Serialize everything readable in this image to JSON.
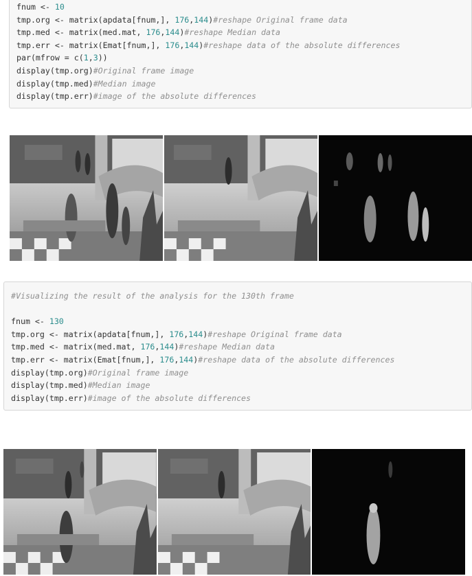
{
  "block1": {
    "l1": {
      "a": "fnum <- ",
      "n": "10"
    },
    "l2": {
      "a": "tmp.org <- matrix(apdata[fnum,], ",
      "n1": "176",
      "b": ",",
      "n2": "144",
      "c": ")",
      "cm": "#reshape Original frame data"
    },
    "l3": {
      "a": "tmp.med <- matrix(med.mat, ",
      "n1": "176",
      "b": ",",
      "n2": "144",
      "c": ")",
      "cm": "#reshape Median data"
    },
    "l4": {
      "a": "tmp.err <- matrix(Emat[fnum,], ",
      "n1": "176",
      "b": ",",
      "n2": "144",
      "c": ")",
      "cm": "#reshape data of the absolute differences"
    },
    "l5": {
      "a": "par(mfrow = c(",
      "n1": "1",
      "b": ",",
      "n2": "3",
      "c": "))"
    },
    "l6": {
      "a": "display(tmp.org)",
      "cm": "#Original frame image"
    },
    "l7": {
      "a": "display(tmp.med)",
      "cm": "#Median image"
    },
    "l8": {
      "a": "display(tmp.err)",
      "cm": "#image of the absolute differences"
    }
  },
  "block2": {
    "c0": "#Visualizing the result of the analysis for the 130th frame",
    "l1": {
      "a": "fnum <- ",
      "n": "130"
    },
    "l2": {
      "a": "tmp.org <- matrix(apdata[fnum,], ",
      "n1": "176",
      "b": ",",
      "n2": "144",
      "c": ")",
      "cm": "#reshape Original frame data"
    },
    "l3": {
      "a": "tmp.med <- matrix(med.mat, ",
      "n1": "176",
      "b": ",",
      "n2": "144",
      "c": ")",
      "cm": "#reshape Median data"
    },
    "l4": {
      "a": "tmp.err <- matrix(Emat[fnum,], ",
      "n1": "176",
      "b": ",",
      "n2": "144",
      "c": ")",
      "cm": "#reshape data of the absolute differences"
    },
    "l5": {
      "a": "display(tmp.org)",
      "cm": "#Original frame image"
    },
    "l6": {
      "a": "display(tmp.med)",
      "cm": "#Median image"
    },
    "l7": {
      "a": "display(tmp.err)",
      "cm": "#image of the absolute differences"
    }
  }
}
